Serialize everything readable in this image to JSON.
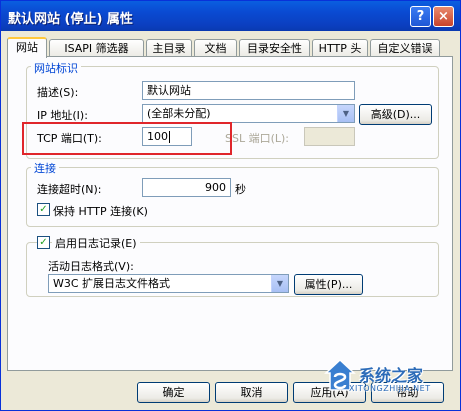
{
  "window": {
    "title": "默认网站 (停止) 属性",
    "help_glyph": "?",
    "close_glyph": "×"
  },
  "tabs": [
    "网站",
    "ISAPI 筛选器",
    "主目录",
    "文档",
    "目录安全性",
    "HTTP 头",
    "自定义错误"
  ],
  "site_id_group": {
    "legend": "网站标识",
    "description_label": "描述(S):",
    "description_value": "默认网站",
    "ip_label": "IP 地址(I):",
    "ip_value": "(全部未分配)",
    "advanced_button": "高级(D)...",
    "tcp_label": "TCP 端口(T):",
    "tcp_value": "100",
    "ssl_label": "SSL 端口(L):",
    "ssl_value": ""
  },
  "connection_group": {
    "legend": "连接",
    "timeout_label": "连接超时(N):",
    "timeout_value": "900",
    "timeout_unit": "秒",
    "keepalive_label": "保持 HTTP 连接(K)",
    "keepalive_checked": true
  },
  "logging_group": {
    "enable_label": "启用日志记录(E)",
    "enable_checked": true,
    "format_label": "活动日志格式(V):",
    "format_value": "W3C 扩展日志文件格式",
    "properties_button": "属性(P)..."
  },
  "footer": {
    "ok_button": "确定",
    "cancel_button": "取消",
    "apply_button": "应用(A)",
    "help_button": "帮助"
  },
  "watermark": {
    "text": "系统之家",
    "subtext": "XITONGZHIJIA.NET"
  },
  "colors": {
    "title_bar": "#0a4bd3",
    "highlight_box": "#e0262b",
    "group_legend": "#0046d5"
  }
}
